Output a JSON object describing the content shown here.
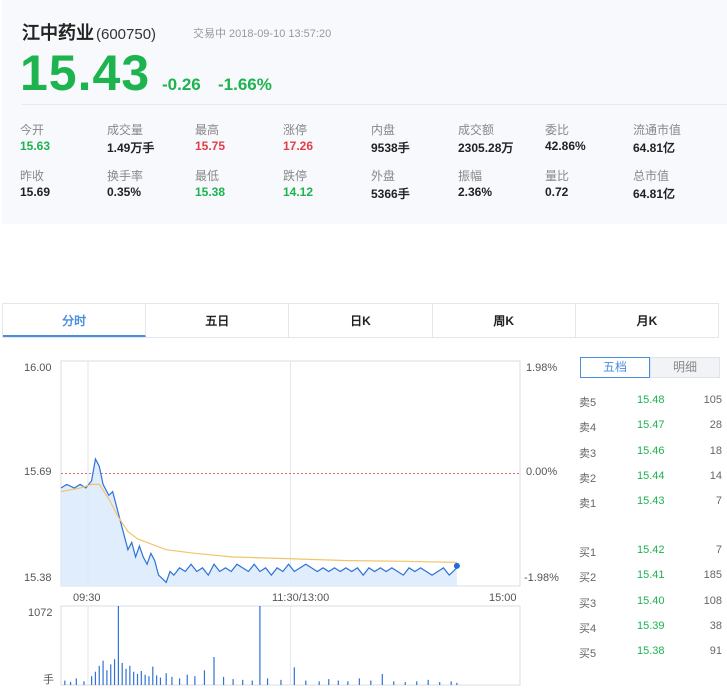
{
  "header": {
    "name": "江中药业",
    "code": "(600750)",
    "status": "交易中 2018-09-10 13:57:20",
    "price": "15.43",
    "change": "-0.26",
    "change_pct": "-1.66%"
  },
  "stats": [
    {
      "label": "今开",
      "value": "15.63",
      "tone": "green"
    },
    {
      "label": "成交量",
      "value": "1.49万手",
      "tone": "normal"
    },
    {
      "label": "最高",
      "value": "15.75",
      "tone": "red"
    },
    {
      "label": "涨停",
      "value": "17.26",
      "tone": "red"
    },
    {
      "label": "内盘",
      "value": "9538手",
      "tone": "normal"
    },
    {
      "label": "成交额",
      "value": "2305.28万",
      "tone": "normal"
    },
    {
      "label": "委比",
      "value": "42.86%",
      "tone": "normal"
    },
    {
      "label": "流通市值",
      "value": "64.81亿",
      "tone": "normal"
    },
    {
      "label": "昨收",
      "value": "15.69",
      "tone": "normal"
    },
    {
      "label": "换手率",
      "value": "0.35%",
      "tone": "normal"
    },
    {
      "label": "最低",
      "value": "15.38",
      "tone": "green"
    },
    {
      "label": "跌停",
      "value": "14.12",
      "tone": "green"
    },
    {
      "label": "外盘",
      "value": "5366手",
      "tone": "normal"
    },
    {
      "label": "振幅",
      "value": "2.36%",
      "tone": "normal"
    },
    {
      "label": "量比",
      "value": "0.72",
      "tone": "normal"
    },
    {
      "label": "总市值",
      "value": "64.81亿",
      "tone": "normal"
    }
  ],
  "tabs": [
    "分时",
    "五日",
    "日K",
    "周K",
    "月K"
  ],
  "active_tab": 0,
  "price_axis": {
    "top": "16.00",
    "mid": "15.69",
    "bottom": "15.38"
  },
  "pct_axis": {
    "top": "1.98%",
    "mid": "0.00%",
    "bottom": "-1.98%"
  },
  "time_axis": [
    "09:30",
    "11:30/13:00",
    "15:00"
  ],
  "volume_axis": {
    "top": "1072",
    "unit": "手"
  },
  "orderbook_tabs": [
    "五档",
    "明细"
  ],
  "orderbook": {
    "asks": [
      {
        "name": "卖5",
        "price": "15.48",
        "vol": "105"
      },
      {
        "name": "卖4",
        "price": "15.47",
        "vol": "28"
      },
      {
        "name": "卖3",
        "price": "15.46",
        "vol": "18"
      },
      {
        "name": "卖2",
        "price": "15.44",
        "vol": "14"
      },
      {
        "name": "卖1",
        "price": "15.43",
        "vol": "7"
      }
    ],
    "bids": [
      {
        "name": "买1",
        "price": "15.42",
        "vol": "7"
      },
      {
        "name": "买2",
        "price": "15.41",
        "vol": "185"
      },
      {
        "name": "买3",
        "price": "15.40",
        "vol": "108"
      },
      {
        "name": "买4",
        "price": "15.39",
        "vol": "38"
      },
      {
        "name": "买5",
        "price": "15.38",
        "vol": "91"
      }
    ]
  },
  "colors": {
    "up": "#e33d47",
    "down": "#1db34f",
    "accent": "#4a8ee0",
    "avg_line": "#f2c46d"
  },
  "chart_data": {
    "type": "line",
    "title": "",
    "prev_close": 15.69,
    "ylim": [
      15.38,
      16.0
    ],
    "session_minutes": 240,
    "elapsed_minutes": 207,
    "price_series": [
      [
        0,
        15.65
      ],
      [
        3,
        15.66
      ],
      [
        7,
        15.65
      ],
      [
        10,
        15.66
      ],
      [
        13,
        15.65
      ],
      [
        16,
        15.67
      ],
      [
        18,
        15.73
      ],
      [
        20,
        15.71
      ],
      [
        22,
        15.66
      ],
      [
        25,
        15.63
      ],
      [
        27,
        15.64
      ],
      [
        29,
        15.6
      ],
      [
        31,
        15.56
      ],
      [
        33,
        15.52
      ],
      [
        35,
        15.48
      ],
      [
        37,
        15.5
      ],
      [
        39,
        15.46
      ],
      [
        41,
        15.49
      ],
      [
        43,
        15.46
      ],
      [
        45,
        15.44
      ],
      [
        47,
        15.47
      ],
      [
        49,
        15.45
      ],
      [
        51,
        15.41
      ],
      [
        53,
        15.4
      ],
      [
        55,
        15.39
      ],
      [
        57,
        15.42
      ],
      [
        59,
        15.41
      ],
      [
        62,
        15.43
      ],
      [
        65,
        15.42
      ],
      [
        68,
        15.44
      ],
      [
        71,
        15.42
      ],
      [
        74,
        15.43
      ],
      [
        77,
        15.41
      ],
      [
        80,
        15.44
      ],
      [
        83,
        15.42
      ],
      [
        86,
        15.43
      ],
      [
        89,
        15.42
      ],
      [
        92,
        15.44
      ],
      [
        95,
        15.43
      ],
      [
        98,
        15.42
      ],
      [
        101,
        15.44
      ],
      [
        104,
        15.42
      ],
      [
        107,
        15.43
      ],
      [
        110,
        15.41
      ],
      [
        113,
        15.43
      ],
      [
        116,
        15.42
      ],
      [
        119,
        15.44
      ],
      [
        122,
        15.42
      ],
      [
        125,
        15.43
      ],
      [
        128,
        15.44
      ],
      [
        131,
        15.43
      ],
      [
        134,
        15.42
      ],
      [
        137,
        15.43
      ],
      [
        140,
        15.42
      ],
      [
        143,
        15.43
      ],
      [
        146,
        15.42
      ],
      [
        149,
        15.43
      ],
      [
        152,
        15.42
      ],
      [
        155,
        15.43
      ],
      [
        158,
        15.41
      ],
      [
        161,
        15.43
      ],
      [
        164,
        15.42
      ],
      [
        167,
        15.43
      ],
      [
        170,
        15.42
      ],
      [
        173,
        15.43
      ],
      [
        176,
        15.42
      ],
      [
        179,
        15.41
      ],
      [
        182,
        15.43
      ],
      [
        185,
        15.42
      ],
      [
        188,
        15.43
      ],
      [
        191,
        15.42
      ],
      [
        194,
        15.41
      ],
      [
        197,
        15.42
      ],
      [
        200,
        15.43
      ],
      [
        203,
        15.41
      ],
      [
        205,
        15.42
      ],
      [
        207,
        15.43
      ]
    ],
    "avg_series": [
      [
        0,
        15.64
      ],
      [
        10,
        15.65
      ],
      [
        16,
        15.66
      ],
      [
        20,
        15.66
      ],
      [
        25,
        15.62
      ],
      [
        30,
        15.57
      ],
      [
        35,
        15.53
      ],
      [
        40,
        15.51
      ],
      [
        45,
        15.5
      ],
      [
        55,
        15.48
      ],
      [
        70,
        15.47
      ],
      [
        90,
        15.46
      ],
      [
        120,
        15.455
      ],
      [
        150,
        15.45
      ],
      [
        180,
        15.448
      ],
      [
        207,
        15.445
      ]
    ],
    "volume_ylim": [
      0,
      1072
    ],
    "volume": [
      [
        2,
        60
      ],
      [
        5,
        40
      ],
      [
        8,
        90
      ],
      [
        12,
        50
      ],
      [
        16,
        120
      ],
      [
        18,
        180
      ],
      [
        20,
        260
      ],
      [
        22,
        330
      ],
      [
        24,
        200
      ],
      [
        26,
        280
      ],
      [
        28,
        350
      ],
      [
        30,
        1072
      ],
      [
        32,
        300
      ],
      [
        34,
        220
      ],
      [
        36,
        260
      ],
      [
        38,
        180
      ],
      [
        40,
        150
      ],
      [
        42,
        190
      ],
      [
        44,
        140
      ],
      [
        46,
        120
      ],
      [
        48,
        250
      ],
      [
        50,
        130
      ],
      [
        52,
        100
      ],
      [
        55,
        160
      ],
      [
        58,
        110
      ],
      [
        62,
        90
      ],
      [
        66,
        140
      ],
      [
        70,
        120
      ],
      [
        75,
        200
      ],
      [
        80,
        380
      ],
      [
        85,
        110
      ],
      [
        90,
        80
      ],
      [
        95,
        70
      ],
      [
        100,
        60
      ],
      [
        104,
        1072
      ],
      [
        108,
        90
      ],
      [
        115,
        70
      ],
      [
        122,
        240
      ],
      [
        128,
        60
      ],
      [
        135,
        50
      ],
      [
        140,
        80
      ],
      [
        145,
        60
      ],
      [
        150,
        50
      ],
      [
        156,
        90
      ],
      [
        162,
        60
      ],
      [
        168,
        150
      ],
      [
        174,
        50
      ],
      [
        180,
        40
      ],
      [
        186,
        50
      ],
      [
        192,
        70
      ],
      [
        198,
        40
      ],
      [
        204,
        50
      ],
      [
        207,
        30
      ]
    ]
  }
}
